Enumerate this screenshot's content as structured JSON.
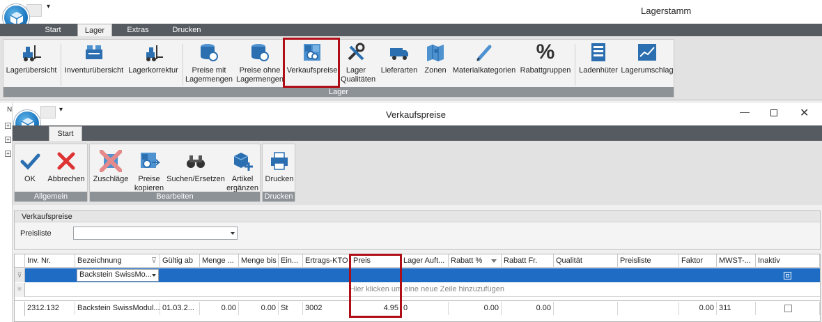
{
  "main_window": {
    "title": "Lagerstamm",
    "tabs": [
      {
        "label": "Start"
      },
      {
        "label": "Lager"
      },
      {
        "label": "Extras"
      },
      {
        "label": "Drucken"
      }
    ],
    "ribbon": {
      "group_label": "Lager",
      "buttons": [
        {
          "label": "Lagerübersicht",
          "icon": "forklift-icon"
        },
        {
          "label": "Inventurübersicht",
          "icon": "inventory-boxes-icon"
        },
        {
          "label": "Lagerkorrektur",
          "icon": "forklift-correction-icon"
        },
        {
          "label": "Preise mit Lagermengen",
          "icon": "coin-stack-icon"
        },
        {
          "label": "Preise ohne Lagermengen",
          "icon": "coin-stack-icon"
        },
        {
          "label": "Verkaufspreise",
          "icon": "price-tags-icon"
        },
        {
          "label": "Lager Qualitäten",
          "icon": "tools-icon"
        },
        {
          "label": "Lieferarten",
          "icon": "truck-icon"
        },
        {
          "label": "Zonen",
          "icon": "map-icon"
        },
        {
          "label": "Materialkategorien",
          "icon": "pencil-icon"
        },
        {
          "label": "Rabattgruppen",
          "icon": "percent-icon"
        },
        {
          "label": "Ladenhüter",
          "icon": "list-icon"
        },
        {
          "label": "Lagerumschlag",
          "icon": "chart-line-icon"
        }
      ]
    },
    "tree_strip_letter": "N"
  },
  "child_window": {
    "title": "Verkaufspreise",
    "tabs": [
      {
        "label": "Start"
      }
    ],
    "ribbon": {
      "groups": [
        {
          "label": "Allgemein",
          "buttons": [
            {
              "label": "OK",
              "icon": "checkmark-icon"
            },
            {
              "label": "Abbrechen",
              "icon": "close-x-icon"
            }
          ]
        },
        {
          "label": "Bearbeiten",
          "buttons": [
            {
              "label": "Zuschläge",
              "icon": "surcharge-icon"
            },
            {
              "label": "Preise kopieren",
              "icon": "copy-prices-icon"
            },
            {
              "label": "Suchen/Ersetzen",
              "icon": "binoculars-icon"
            },
            {
              "label": "Artikel ergänzen",
              "icon": "add-cube-icon"
            }
          ]
        },
        {
          "label": "Drucken",
          "buttons": [
            {
              "label": "Drucken",
              "icon": "printer-icon"
            }
          ]
        }
      ]
    },
    "section_title": "Verkaufspreise",
    "preisliste_label": "Preisliste",
    "preisliste_value": "",
    "grid": {
      "columns": [
        "Inv. Nr.",
        "Bezeichnung",
        "Gültig ab",
        "Menge ...",
        "Menge bis",
        "Ein...",
        "Ertrags-KTO",
        "Preis",
        "Lager Auft...",
        "Rabatt %",
        "Rabatt Fr.",
        "Qualität",
        "Preisliste",
        "Faktor",
        "MWST-...",
        "Inaktiv"
      ],
      "filter_row_combo": "Backstein SwissMo...",
      "new_row_hint": "Hier klicken um eine neue Zeile hinzuzufügen",
      "rows": [
        {
          "inv_nr": "2312.132",
          "bezeichnung": "Backstein SwissModul...",
          "gueltig_ab": "01.03.2...",
          "menge_von": "0.00",
          "menge_bis": "0.00",
          "einheit": "St",
          "ertrags_kto": "3002",
          "preis": "4.95",
          "lager_auft": "0",
          "rabatt_pct": "0.00",
          "rabatt_fr": "0.00",
          "qualitaet": "",
          "preisliste": "",
          "faktor": "0.00",
          "mwst": "311"
        }
      ]
    }
  },
  "colors": {
    "highlight": "#b00e16",
    "selection": "#1f6cc4",
    "tabbar": "#555b60",
    "group_label": "#8d9296"
  }
}
